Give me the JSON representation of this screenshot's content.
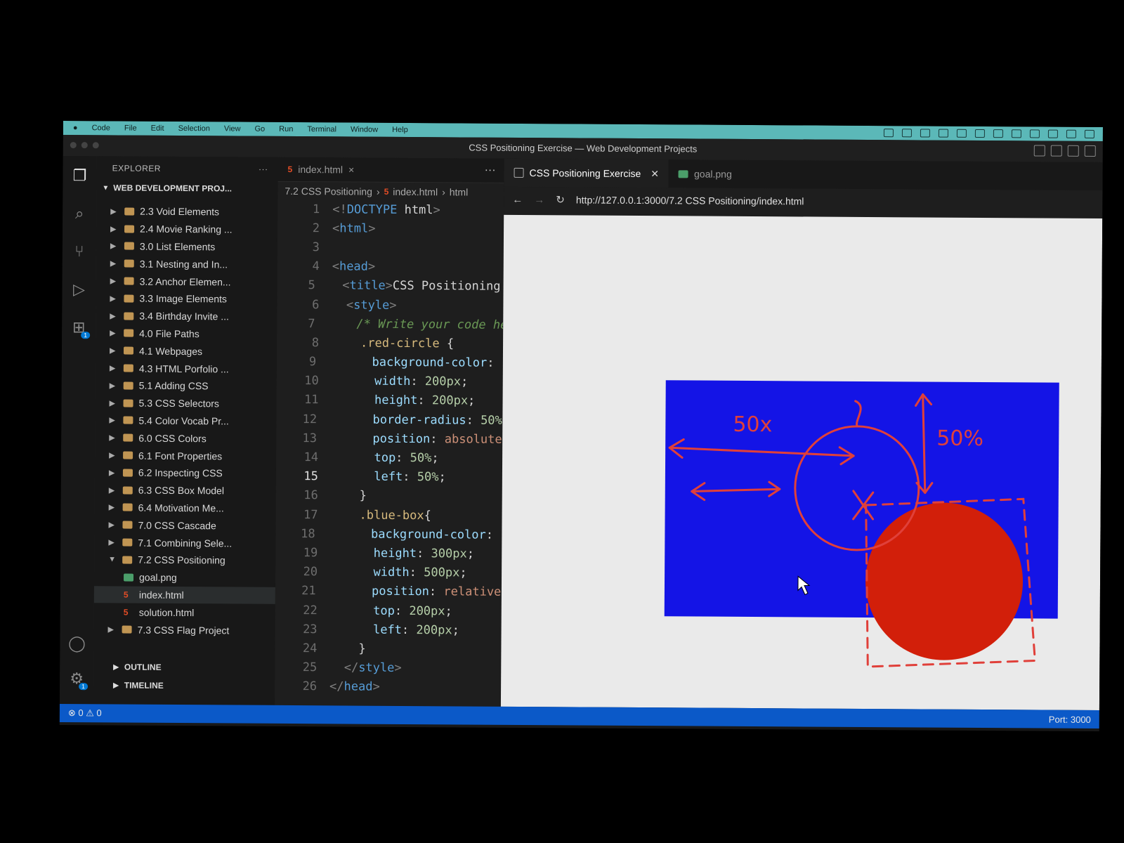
{
  "menubar": {
    "items": [
      "Code",
      "File",
      "Edit",
      "Selection",
      "View",
      "Go",
      "Run",
      "Terminal",
      "Window",
      "Help"
    ]
  },
  "window": {
    "title": "CSS Positioning Exercise — Web Development Projects"
  },
  "explorer": {
    "header": "EXPLORER",
    "more": "···",
    "section": "WEB DEVELOPMENT PROJ...",
    "items": [
      {
        "label": "2.3 Void Elements",
        "type": "folder"
      },
      {
        "label": "2.4 Movie Ranking ...",
        "type": "folder"
      },
      {
        "label": "3.0 List Elements",
        "type": "folder"
      },
      {
        "label": "3.1 Nesting and In...",
        "type": "folder"
      },
      {
        "label": "3.2 Anchor Elemen...",
        "type": "folder"
      },
      {
        "label": "3.3 Image Elements",
        "type": "folder"
      },
      {
        "label": "3.4 Birthday Invite ...",
        "type": "folder"
      },
      {
        "label": "4.0 File Paths",
        "type": "folder"
      },
      {
        "label": "4.1 Webpages",
        "type": "folder"
      },
      {
        "label": "4.3 HTML Porfolio ...",
        "type": "folder"
      },
      {
        "label": "5.1 Adding CSS",
        "type": "folder"
      },
      {
        "label": "5.3 CSS Selectors",
        "type": "folder"
      },
      {
        "label": "5.4 Color Vocab Pr...",
        "type": "folder"
      },
      {
        "label": "6.0 CSS Colors",
        "type": "folder"
      },
      {
        "label": "6.1 Font Properties",
        "type": "folder"
      },
      {
        "label": "6.2 Inspecting CSS",
        "type": "folder"
      },
      {
        "label": "6.3 CSS Box Model",
        "type": "folder"
      },
      {
        "label": "6.4 Motivation Me...",
        "type": "folder"
      },
      {
        "label": "7.0 CSS Cascade",
        "type": "folder"
      },
      {
        "label": "7.1 Combining Sele...",
        "type": "folder"
      },
      {
        "label": "7.2 CSS Positioning",
        "type": "folder-open"
      },
      {
        "label": "goal.png",
        "type": "png"
      },
      {
        "label": "index.html",
        "type": "html"
      },
      {
        "label": "solution.html",
        "type": "html"
      },
      {
        "label": "7.3 CSS Flag Project",
        "type": "folder"
      }
    ],
    "outline": "OUTLINE",
    "timeline": "TIMELINE"
  },
  "editor": {
    "tab": "index.html",
    "more": "···",
    "breadcrumb": [
      "7.2 CSS Positioning",
      "index.html",
      "html"
    ],
    "current_line": 15,
    "colors": {
      "red_swatch": "#e8321a",
      "blue_swatch": "#1a1aff"
    },
    "lines": [
      {
        "n": "1",
        "segs": [
          [
            "t-tag",
            "<!"
          ],
          [
            "t-name",
            "DOCTYPE"
          ],
          [
            "txt",
            " html"
          ],
          [
            "t-tag",
            ">"
          ]
        ]
      },
      {
        "n": "2",
        "segs": [
          [
            "t-tag",
            "<"
          ],
          [
            "t-name",
            "html"
          ],
          [
            "t-tag",
            ">"
          ]
        ]
      },
      {
        "n": "3",
        "segs": []
      },
      {
        "n": "4",
        "segs": [
          [
            "t-tag",
            "<"
          ],
          [
            "t-name",
            "head"
          ],
          [
            "t-tag",
            ">"
          ]
        ]
      },
      {
        "n": "5",
        "segs": [
          [
            "txt",
            "  "
          ],
          [
            "t-tag",
            "<"
          ],
          [
            "t-name",
            "title"
          ],
          [
            "t-tag",
            ">"
          ],
          [
            "txt",
            "CSS Positioning Ex"
          ]
        ]
      },
      {
        "n": "6",
        "segs": [
          [
            "txt",
            "  "
          ],
          [
            "t-tag",
            "<"
          ],
          [
            "t-name",
            "style"
          ],
          [
            "t-tag",
            ">"
          ]
        ]
      },
      {
        "n": "7",
        "segs": [
          [
            "txt",
            "    "
          ],
          [
            "t-com",
            "/* Write your code here"
          ]
        ]
      },
      {
        "n": "8",
        "segs": [
          [
            "txt",
            "    "
          ],
          [
            "t-sel",
            ".red-circle"
          ],
          [
            "txt",
            " {"
          ]
        ]
      },
      {
        "n": "9",
        "segs": [
          [
            "txt",
            "      "
          ],
          [
            "t-prop",
            "background-color"
          ],
          [
            "txt",
            ": "
          ]
        ],
        "swatch": "red"
      },
      {
        "n": "10",
        "segs": [
          [
            "txt",
            "      "
          ],
          [
            "t-prop",
            "width"
          ],
          [
            "txt",
            ": "
          ],
          [
            "t-num",
            "200px"
          ],
          [
            "txt",
            ";"
          ]
        ]
      },
      {
        "n": "11",
        "segs": [
          [
            "txt",
            "      "
          ],
          [
            "t-prop",
            "height"
          ],
          [
            "txt",
            ": "
          ],
          [
            "t-num",
            "200px"
          ],
          [
            "txt",
            ";"
          ]
        ]
      },
      {
        "n": "12",
        "segs": [
          [
            "txt",
            "      "
          ],
          [
            "t-prop",
            "border-radius"
          ],
          [
            "txt",
            ": "
          ],
          [
            "t-num",
            "50%"
          ],
          [
            "txt",
            ";"
          ]
        ]
      },
      {
        "n": "13",
        "segs": [
          [
            "txt",
            "      "
          ],
          [
            "t-prop",
            "position"
          ],
          [
            "txt",
            ": "
          ],
          [
            "t-val",
            "absolute"
          ],
          [
            "txt",
            ";"
          ]
        ]
      },
      {
        "n": "14",
        "segs": [
          [
            "txt",
            "      "
          ],
          [
            "t-prop",
            "top"
          ],
          [
            "txt",
            ": "
          ],
          [
            "t-num",
            "50%"
          ],
          [
            "txt",
            ";"
          ]
        ]
      },
      {
        "n": "15",
        "segs": [
          [
            "txt",
            "      "
          ],
          [
            "t-prop",
            "left"
          ],
          [
            "txt",
            ": "
          ],
          [
            "t-num",
            "50%"
          ],
          [
            "txt",
            ";"
          ]
        ]
      },
      {
        "n": "16",
        "segs": [
          [
            "txt",
            "    }"
          ]
        ]
      },
      {
        "n": "17",
        "segs": [
          [
            "txt",
            "    "
          ],
          [
            "t-sel",
            ".blue-box"
          ],
          [
            "txt",
            "{"
          ]
        ]
      },
      {
        "n": "18",
        "segs": [
          [
            "txt",
            "      "
          ],
          [
            "t-prop",
            "background-color"
          ],
          [
            "txt",
            ": "
          ]
        ],
        "swatch": "blue"
      },
      {
        "n": "19",
        "segs": [
          [
            "txt",
            "      "
          ],
          [
            "t-prop",
            "height"
          ],
          [
            "txt",
            ": "
          ],
          [
            "t-num",
            "300px"
          ],
          [
            "txt",
            ";"
          ]
        ]
      },
      {
        "n": "20",
        "segs": [
          [
            "txt",
            "      "
          ],
          [
            "t-prop",
            "width"
          ],
          [
            "txt",
            ": "
          ],
          [
            "t-num",
            "500px"
          ],
          [
            "txt",
            ";"
          ]
        ]
      },
      {
        "n": "21",
        "segs": [
          [
            "txt",
            "      "
          ],
          [
            "t-prop",
            "position"
          ],
          [
            "txt",
            ": "
          ],
          [
            "t-val",
            "relative"
          ],
          [
            "txt",
            ";"
          ]
        ]
      },
      {
        "n": "22",
        "segs": [
          [
            "txt",
            "      "
          ],
          [
            "t-prop",
            "top"
          ],
          [
            "txt",
            ": "
          ],
          [
            "t-num",
            "200px"
          ],
          [
            "txt",
            ";"
          ]
        ]
      },
      {
        "n": "23",
        "segs": [
          [
            "txt",
            "      "
          ],
          [
            "t-prop",
            "left"
          ],
          [
            "txt",
            ": "
          ],
          [
            "t-num",
            "200px"
          ],
          [
            "txt",
            ";"
          ]
        ]
      },
      {
        "n": "24",
        "segs": [
          [
            "txt",
            "    }"
          ]
        ]
      },
      {
        "n": "25",
        "segs": [
          [
            "txt",
            "  "
          ],
          [
            "t-tag",
            "</"
          ],
          [
            "t-name",
            "style"
          ],
          [
            "t-tag",
            ">"
          ]
        ]
      },
      {
        "n": "26",
        "segs": [
          [
            "t-tag",
            "</"
          ],
          [
            "t-name",
            "head"
          ],
          [
            "t-tag",
            ">"
          ]
        ]
      }
    ]
  },
  "preview": {
    "tab_active": "CSS Positioning Exercise",
    "tab_close": "✕",
    "tab_image": "goal.png",
    "url": "http://127.0.0.1:3000/7.2 CSS Positioning/index.html",
    "annotations": {
      "left_label": "50x",
      "right_label": "50%"
    },
    "colors": {
      "blue_box": "#1414e6",
      "red_circle": "#d21f0a",
      "ink": "#e0403a"
    }
  },
  "statusbar": {
    "problems": "⊗ 0 ⚠ 0",
    "port": "Port: 3000"
  }
}
